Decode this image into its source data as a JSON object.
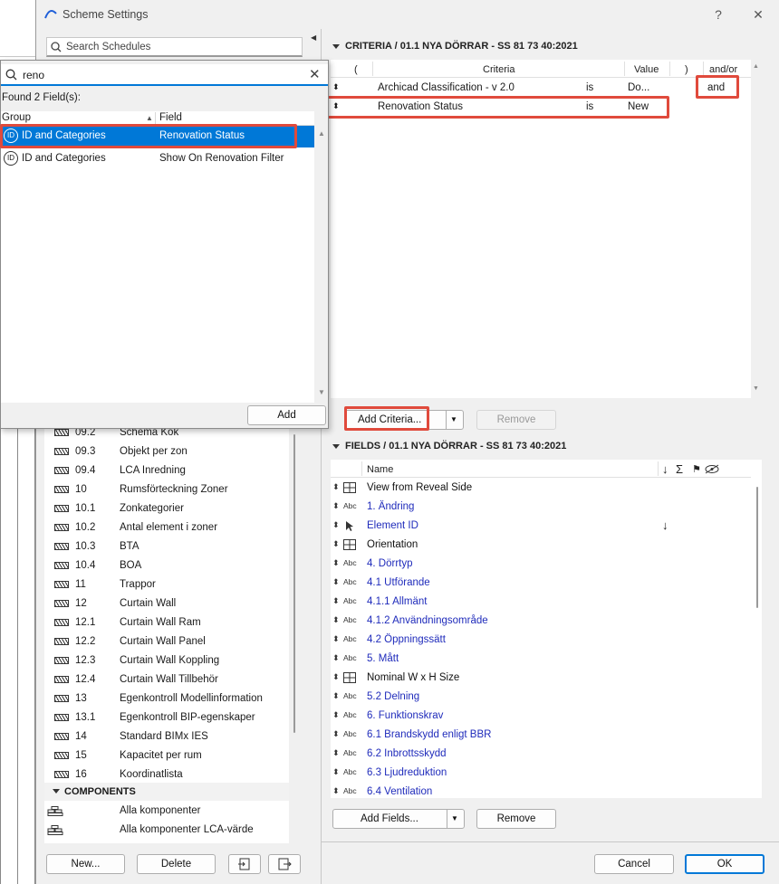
{
  "window": {
    "title": "Scheme Settings",
    "help_label": "?",
    "close_label": "✕"
  },
  "left": {
    "search_placeholder": "Search Schedules",
    "list_items": [
      {
        "num": "09.2",
        "name": "Schema Kök"
      },
      {
        "num": "09.3",
        "name": "Objekt per zon"
      },
      {
        "num": "09.4",
        "name": "LCA Inredning"
      },
      {
        "num": "10",
        "name": "Rumsförteckning Zoner"
      },
      {
        "num": "10.1",
        "name": "Zonkategorier"
      },
      {
        "num": "10.2",
        "name": "Antal element i zoner"
      },
      {
        "num": "10.3",
        "name": "BTA"
      },
      {
        "num": "10.4",
        "name": "BOA"
      },
      {
        "num": "11",
        "name": "Trappor"
      },
      {
        "num": "12",
        "name": "Curtain Wall"
      },
      {
        "num": "12.1",
        "name": "Curtain Wall Ram"
      },
      {
        "num": "12.2",
        "name": "Curtain Wall Panel"
      },
      {
        "num": "12.3",
        "name": "Curtain Wall Koppling"
      },
      {
        "num": "12.4",
        "name": "Curtain Wall Tillbehör"
      },
      {
        "num": "13",
        "name": "Egenkontroll Modellinformation"
      },
      {
        "num": "13.1",
        "name": "Egenkontroll BIP-egenskaper"
      },
      {
        "num": "14",
        "name": "Standard BIMx IES"
      },
      {
        "num": "15",
        "name": "Kapacitet per rum"
      },
      {
        "num": "16",
        "name": "Koordinatlista"
      }
    ],
    "components_header": "COMPONENTS",
    "components": [
      "Alla komponenter",
      "Alla komponenter LCA-värde"
    ],
    "new_label": "New...",
    "delete_label": "Delete"
  },
  "popup": {
    "search_value": "reno",
    "found_text": "Found 2 Field(s):",
    "col_group": "Group",
    "col_field": "Field",
    "rows": [
      {
        "group": "ID and Categories",
        "field": "Renovation Status",
        "selected": true
      },
      {
        "group": "ID and Categories",
        "field": "Show On Renovation Filter",
        "selected": false
      }
    ],
    "add_label": "Add"
  },
  "criteria": {
    "header": "CRITERIA / 01.1 NYA DÖRRAR - SS 81 73 40:2021",
    "col_open": "(",
    "col_criteria": "Criteria",
    "col_value": "Value",
    "col_close": ")",
    "col_andor": "and/or",
    "rows": [
      {
        "criteria": "Archicad Classification - v 2.0",
        "op": "is",
        "value": "Do...",
        "andor": "and"
      },
      {
        "criteria": "Renovation Status",
        "op": "is",
        "value": "New",
        "andor": ""
      }
    ],
    "add_label": "Add Criteria...",
    "remove_label": "Remove"
  },
  "fields": {
    "header": "FIELDS / 01.1 NYA DÖRRAR - SS 81 73 40:2021",
    "col_name": "Name",
    "col_sum": "Σ",
    "rows": [
      {
        "type": "grid",
        "name": "View from Reveal Side",
        "link": false,
        "mark": ""
      },
      {
        "type": "abc",
        "name": "1. Ändring",
        "link": true,
        "mark": ""
      },
      {
        "type": "cursor",
        "name": "Element ID",
        "link": true,
        "mark": "↓"
      },
      {
        "type": "grid",
        "name": "Orientation",
        "link": false,
        "mark": ""
      },
      {
        "type": "abc",
        "name": "4. Dörrtyp",
        "link": true,
        "mark": ""
      },
      {
        "type": "abc",
        "name": "4.1 Utförande",
        "link": true,
        "mark": ""
      },
      {
        "type": "abc",
        "name": "4.1.1 Allmänt",
        "link": true,
        "mark": ""
      },
      {
        "type": "abc",
        "name": "4.1.2 Användningsområde",
        "link": true,
        "mark": ""
      },
      {
        "type": "abc",
        "name": "4.2 Öppningssätt",
        "link": true,
        "mark": ""
      },
      {
        "type": "abc",
        "name": "5. Mått",
        "link": true,
        "mark": ""
      },
      {
        "type": "grid",
        "name": "Nominal W x H Size",
        "link": false,
        "mark": ""
      },
      {
        "type": "abc",
        "name": "5.2 Delning",
        "link": true,
        "mark": ""
      },
      {
        "type": "abc",
        "name": "6. Funktionskrav",
        "link": true,
        "mark": ""
      },
      {
        "type": "abc",
        "name": "6.1 Brandskydd enligt BBR",
        "link": true,
        "mark": ""
      },
      {
        "type": "abc",
        "name": "6.2 Inbrottsskydd",
        "link": true,
        "mark": ""
      },
      {
        "type": "abc",
        "name": "6.3 Ljudreduktion",
        "link": true,
        "mark": ""
      },
      {
        "type": "abc",
        "name": "6.4 Ventilation",
        "link": true,
        "mark": ""
      }
    ],
    "add_label": "Add Fields...",
    "remove_label": "Remove"
  },
  "footer": {
    "cancel_label": "Cancel",
    "ok_label": "OK"
  },
  "icons": {
    "abc_text": "Abc",
    "id_text": "ID"
  },
  "colors": {
    "accent": "#0078d7",
    "highlight": "#e04a3c",
    "link": "#1f2bbb"
  }
}
